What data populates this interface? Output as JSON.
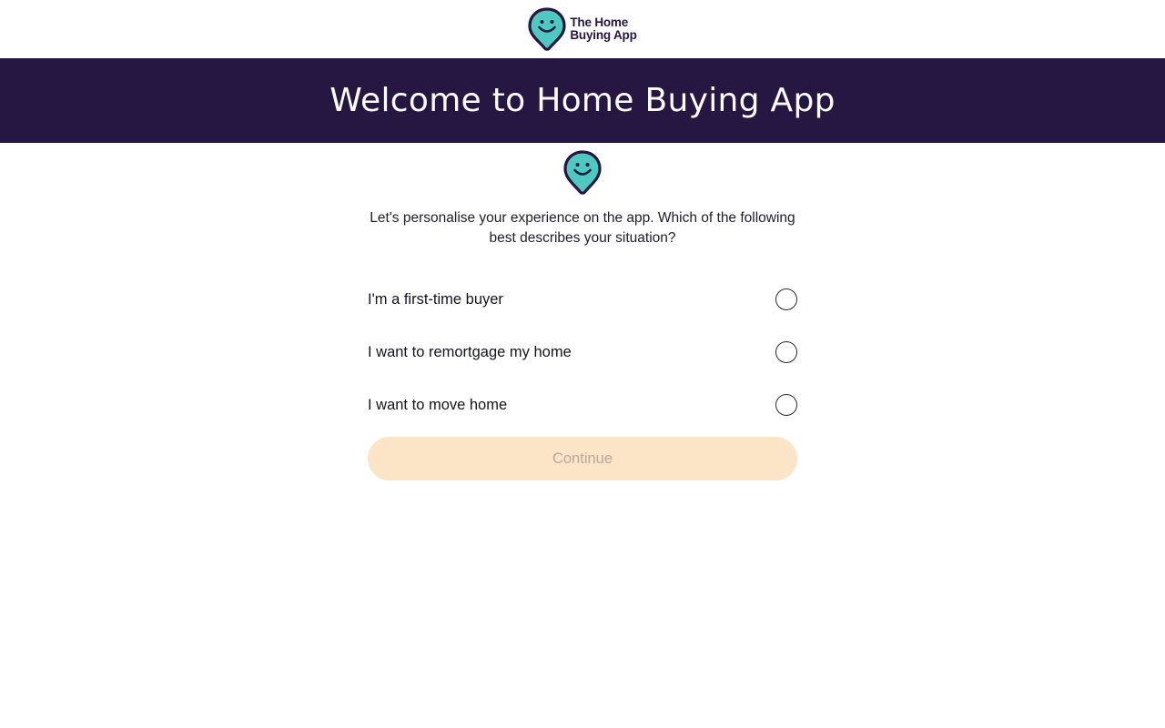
{
  "header": {
    "logo_icon": "smiley-pin-icon",
    "logo_line1": "The Home",
    "logo_line2": "Buying App"
  },
  "banner": {
    "title": "Welcome to Home Buying App",
    "background": "#251642"
  },
  "main": {
    "mascot_icon": "smiley-pin-icon",
    "intro_text": "Let's personalise your experience on the app. Which of the following best describes your situation?",
    "options": [
      {
        "label": "I'm a first-time buyer",
        "selected": false
      },
      {
        "label": "I want to remortgage my home",
        "selected": false
      },
      {
        "label": "I want to move home",
        "selected": false
      }
    ],
    "continue_label": "Continue",
    "continue_enabled": false
  },
  "colors": {
    "brand_dark": "#251642",
    "brand_teal": "#4ec9bf",
    "button_disabled_bg": "#fce4c7",
    "button_disabled_text": "#b6aa9c"
  }
}
